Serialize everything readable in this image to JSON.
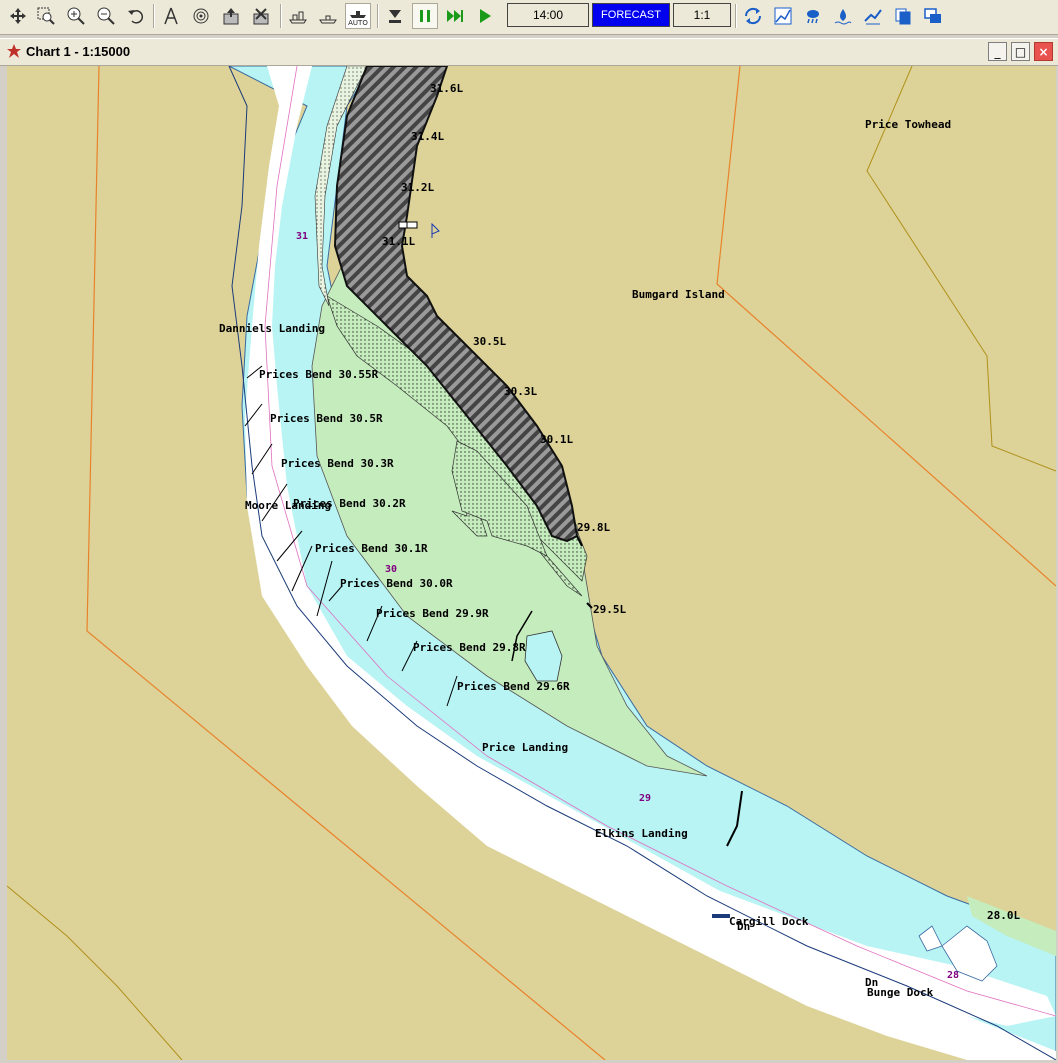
{
  "toolbar": {
    "icons": [
      "pan-icon",
      "zoom-box-icon",
      "zoom-in-icon",
      "zoom-out-icon",
      "undo-zoom-icon",
      "measure-icon",
      "target-icon",
      "export-icon",
      "clear-icon",
      "vessel-icon",
      "vessel-small-icon",
      "auto-icon",
      "download-icon",
      "pause-icon",
      "fast-forward-icon",
      "play-icon",
      "sync-icon",
      "chart-icon",
      "weather-icon",
      "tide-icon",
      "flow-icon",
      "copy-icon",
      "windows-icon"
    ],
    "auto_label": "AUTO",
    "time": "14:00",
    "forecast_label": "FORECAST",
    "scale_ratio": "1:1"
  },
  "window": {
    "title": "Chart 1 - 1:15000",
    "minimize": "_",
    "maximize": "□",
    "close": "×"
  },
  "chart": {
    "colors": {
      "land": "#ddd398",
      "water_deep": "#ffffff",
      "water_shallow": "#b8f4f4",
      "shoal_green": "#c4ecbc",
      "hatched": "#6a6a6a",
      "boundary_orange": "#e8822a",
      "mile_purple": "#800080"
    },
    "place_labels": {
      "price_towhead": "Price Towhead",
      "bumgard_island": "Bumgard Island",
      "danniels_landing": "Danniels Landing",
      "moore_landing": "Moore Landing",
      "price_landing": "Price Landing",
      "elkins_landing": "Elkins Landing",
      "cargill_dock": "Cargill Dock",
      "bunge_dock": "Bunge Dock"
    },
    "left_bank_lights": [
      "31.6L",
      "31.4L",
      "31.2L",
      "31.1L",
      "30.5L",
      "30.3L",
      "30.1L",
      "29.8L",
      "29.5L",
      "28.0L"
    ],
    "right_bank_lights": [
      "Prices Bend 30.55R",
      "Prices Bend 30.5R",
      "Prices Bend 30.3R",
      "Prices Bend 30.2R",
      "Prices Bend 30.1R",
      "Prices Bend 30.0R",
      "Prices Bend 29.9R",
      "Prices Bend 29.8R",
      "Prices Bend 29.6R"
    ],
    "river_miles": [
      "31",
      "30",
      "29",
      "28"
    ],
    "dock_marks": [
      "Dn",
      "Dn"
    ]
  }
}
